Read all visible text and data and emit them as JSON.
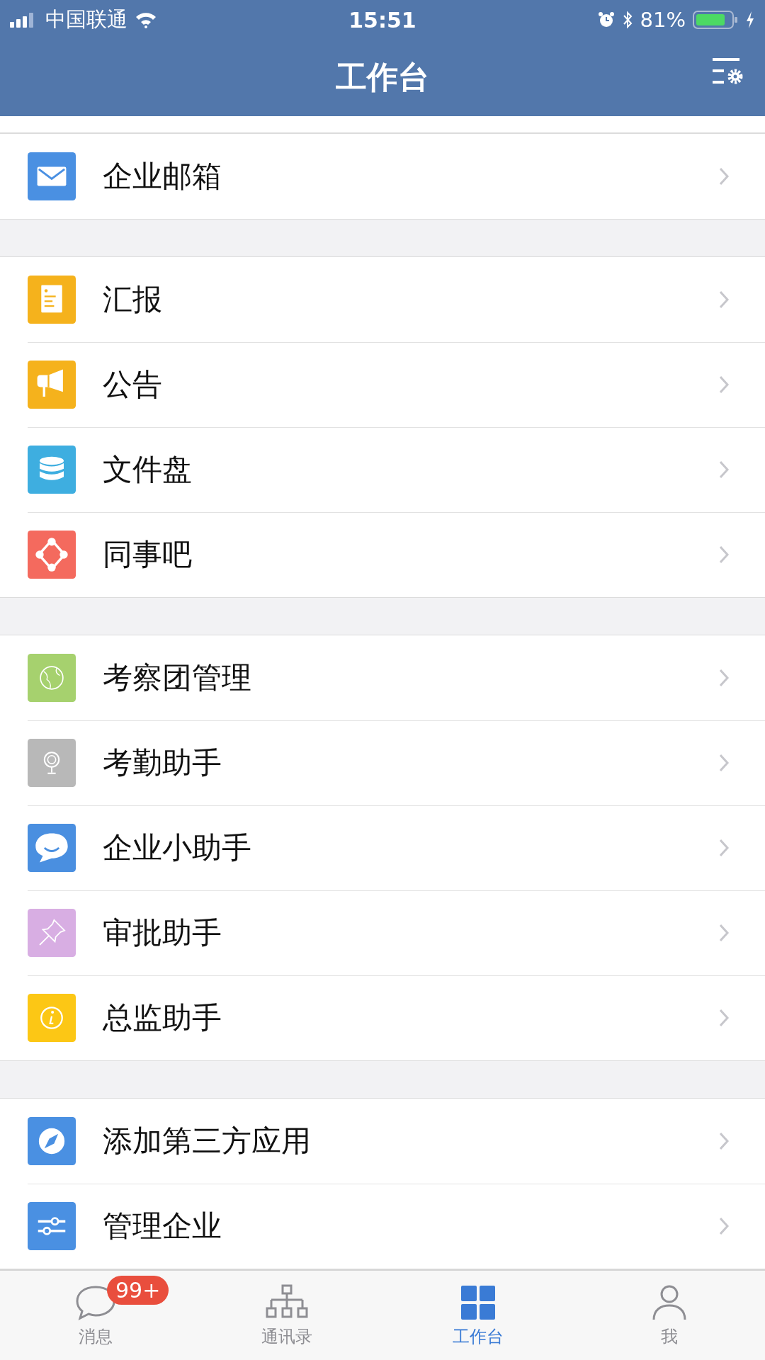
{
  "status_bar": {
    "carrier": "中国联通",
    "time": "15:51",
    "battery": "81%"
  },
  "header": {
    "title": "工作台"
  },
  "groups": [
    {
      "items": [
        {
          "label": "企业邮箱",
          "color": "#4a90e2"
        }
      ]
    },
    {
      "items": [
        {
          "label": "汇报",
          "color": "#f5b21c"
        },
        {
          "label": "公告",
          "color": "#f5b21c"
        },
        {
          "label": "文件盘",
          "color": "#3eaee0"
        },
        {
          "label": "同事吧",
          "color": "#f46a5e"
        }
      ]
    },
    {
      "items": [
        {
          "label": "考察团管理",
          "color": "#a6d16e"
        },
        {
          "label": "考勤助手",
          "color": "#b8b8b8"
        },
        {
          "label": "企业小助手",
          "color": "#4a8fe0"
        },
        {
          "label": "审批助手",
          "color": "#d8aee3"
        },
        {
          "label": "总监助手",
          "color": "#fcc715"
        }
      ]
    },
    {
      "items": [
        {
          "label": "添加第三方应用",
          "color": "#4a90e2"
        },
        {
          "label": "管理企业",
          "color": "#4a90e2"
        }
      ]
    }
  ],
  "tabs": [
    {
      "label": "消息",
      "selected": false,
      "badge": "99+"
    },
    {
      "label": "通讯录",
      "selected": false
    },
    {
      "label": "工作台",
      "selected": true
    },
    {
      "label": "我",
      "selected": false
    }
  ]
}
